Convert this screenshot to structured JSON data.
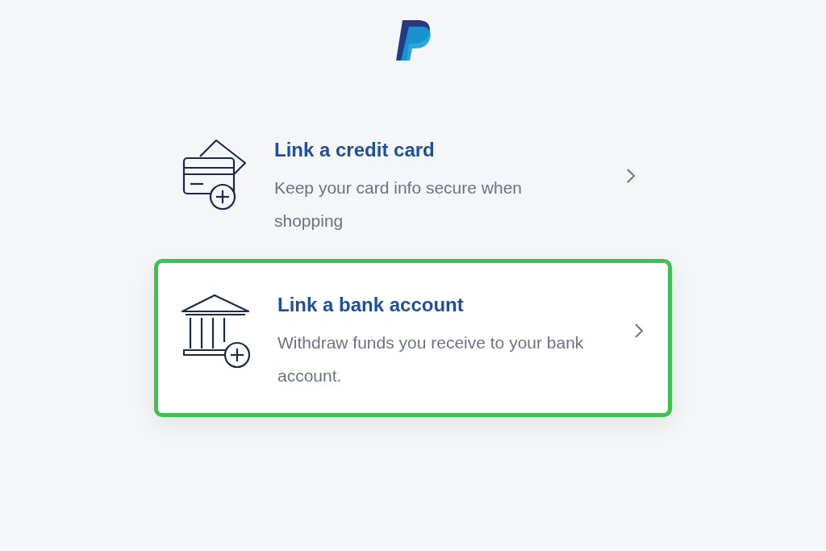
{
  "options": [
    {
      "kind": "card",
      "title": "Link a credit card",
      "description": "Keep your card info secure when shopping",
      "selected": false
    },
    {
      "kind": "bank",
      "title": "Link a bank account",
      "description": "Withdraw funds you receive to your bank account.",
      "selected": true
    }
  ]
}
